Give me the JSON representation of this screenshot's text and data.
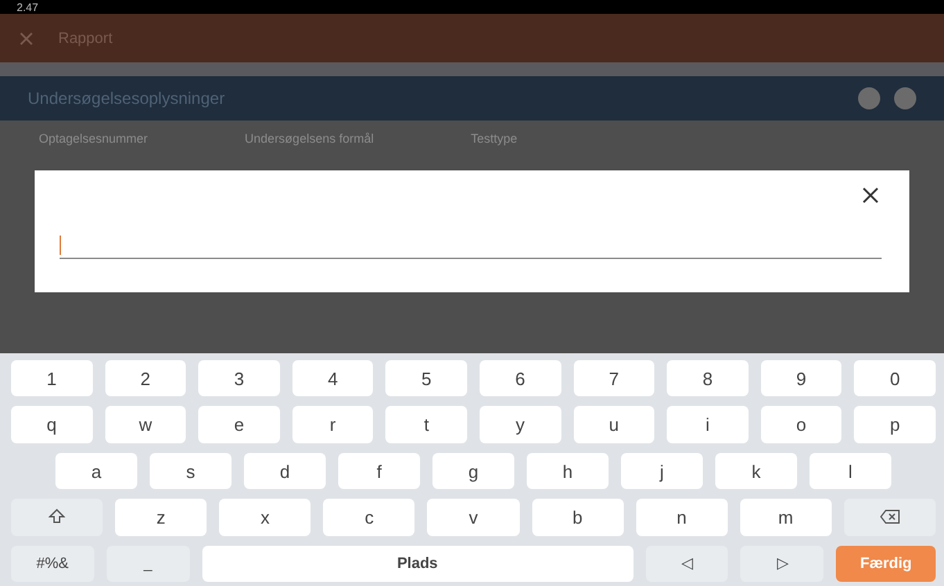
{
  "status_bar": {
    "time": "2.47"
  },
  "app_bar": {
    "title": "Rapport"
  },
  "section": {
    "title": "Undersøgelsesoplysninger"
  },
  "fields": [
    {
      "label": "Optagelsesnummer"
    },
    {
      "label": "Undersøgelsens formål"
    },
    {
      "label": "Testtype"
    }
  ],
  "keyboard": {
    "rows": [
      {
        "keys": [
          {
            "kind": "char",
            "label": "1"
          },
          {
            "kind": "char",
            "label": "2"
          },
          {
            "kind": "char",
            "label": "3"
          },
          {
            "kind": "char",
            "label": "4"
          },
          {
            "kind": "char",
            "label": "5"
          },
          {
            "kind": "char",
            "label": "6"
          },
          {
            "kind": "char",
            "label": "7"
          },
          {
            "kind": "char",
            "label": "8"
          },
          {
            "kind": "char",
            "label": "9"
          },
          {
            "kind": "char",
            "label": "0"
          }
        ]
      },
      {
        "keys": [
          {
            "kind": "char",
            "label": "q"
          },
          {
            "kind": "char",
            "label": "w"
          },
          {
            "kind": "char",
            "label": "e"
          },
          {
            "kind": "char",
            "label": "r"
          },
          {
            "kind": "char",
            "label": "t"
          },
          {
            "kind": "char",
            "label": "y"
          },
          {
            "kind": "char",
            "label": "u"
          },
          {
            "kind": "char",
            "label": "i"
          },
          {
            "kind": "char",
            "label": "o"
          },
          {
            "kind": "char",
            "label": "p"
          }
        ]
      },
      {
        "keys": [
          {
            "kind": "char",
            "label": "a"
          },
          {
            "kind": "char",
            "label": "s"
          },
          {
            "kind": "char",
            "label": "d"
          },
          {
            "kind": "char",
            "label": "f"
          },
          {
            "kind": "char",
            "label": "g"
          },
          {
            "kind": "char",
            "label": "h"
          },
          {
            "kind": "char",
            "label": "j"
          },
          {
            "kind": "char",
            "label": "k"
          },
          {
            "kind": "char",
            "label": "l"
          }
        ]
      },
      {
        "keys": [
          {
            "kind": "shift"
          },
          {
            "kind": "char",
            "label": "z"
          },
          {
            "kind": "char",
            "label": "x"
          },
          {
            "kind": "char",
            "label": "c"
          },
          {
            "kind": "char",
            "label": "v"
          },
          {
            "kind": "char",
            "label": "b"
          },
          {
            "kind": "char",
            "label": "n"
          },
          {
            "kind": "char",
            "label": "m"
          },
          {
            "kind": "backspace"
          }
        ]
      },
      {
        "keys": [
          {
            "kind": "mod",
            "label": "#%&"
          },
          {
            "kind": "mod",
            "label": "_"
          },
          {
            "kind": "space",
            "label": "Plads"
          },
          {
            "kind": "mod",
            "label": "◁"
          },
          {
            "kind": "mod",
            "label": "▷"
          },
          {
            "kind": "done",
            "label": "Færdig"
          }
        ]
      }
    ]
  }
}
